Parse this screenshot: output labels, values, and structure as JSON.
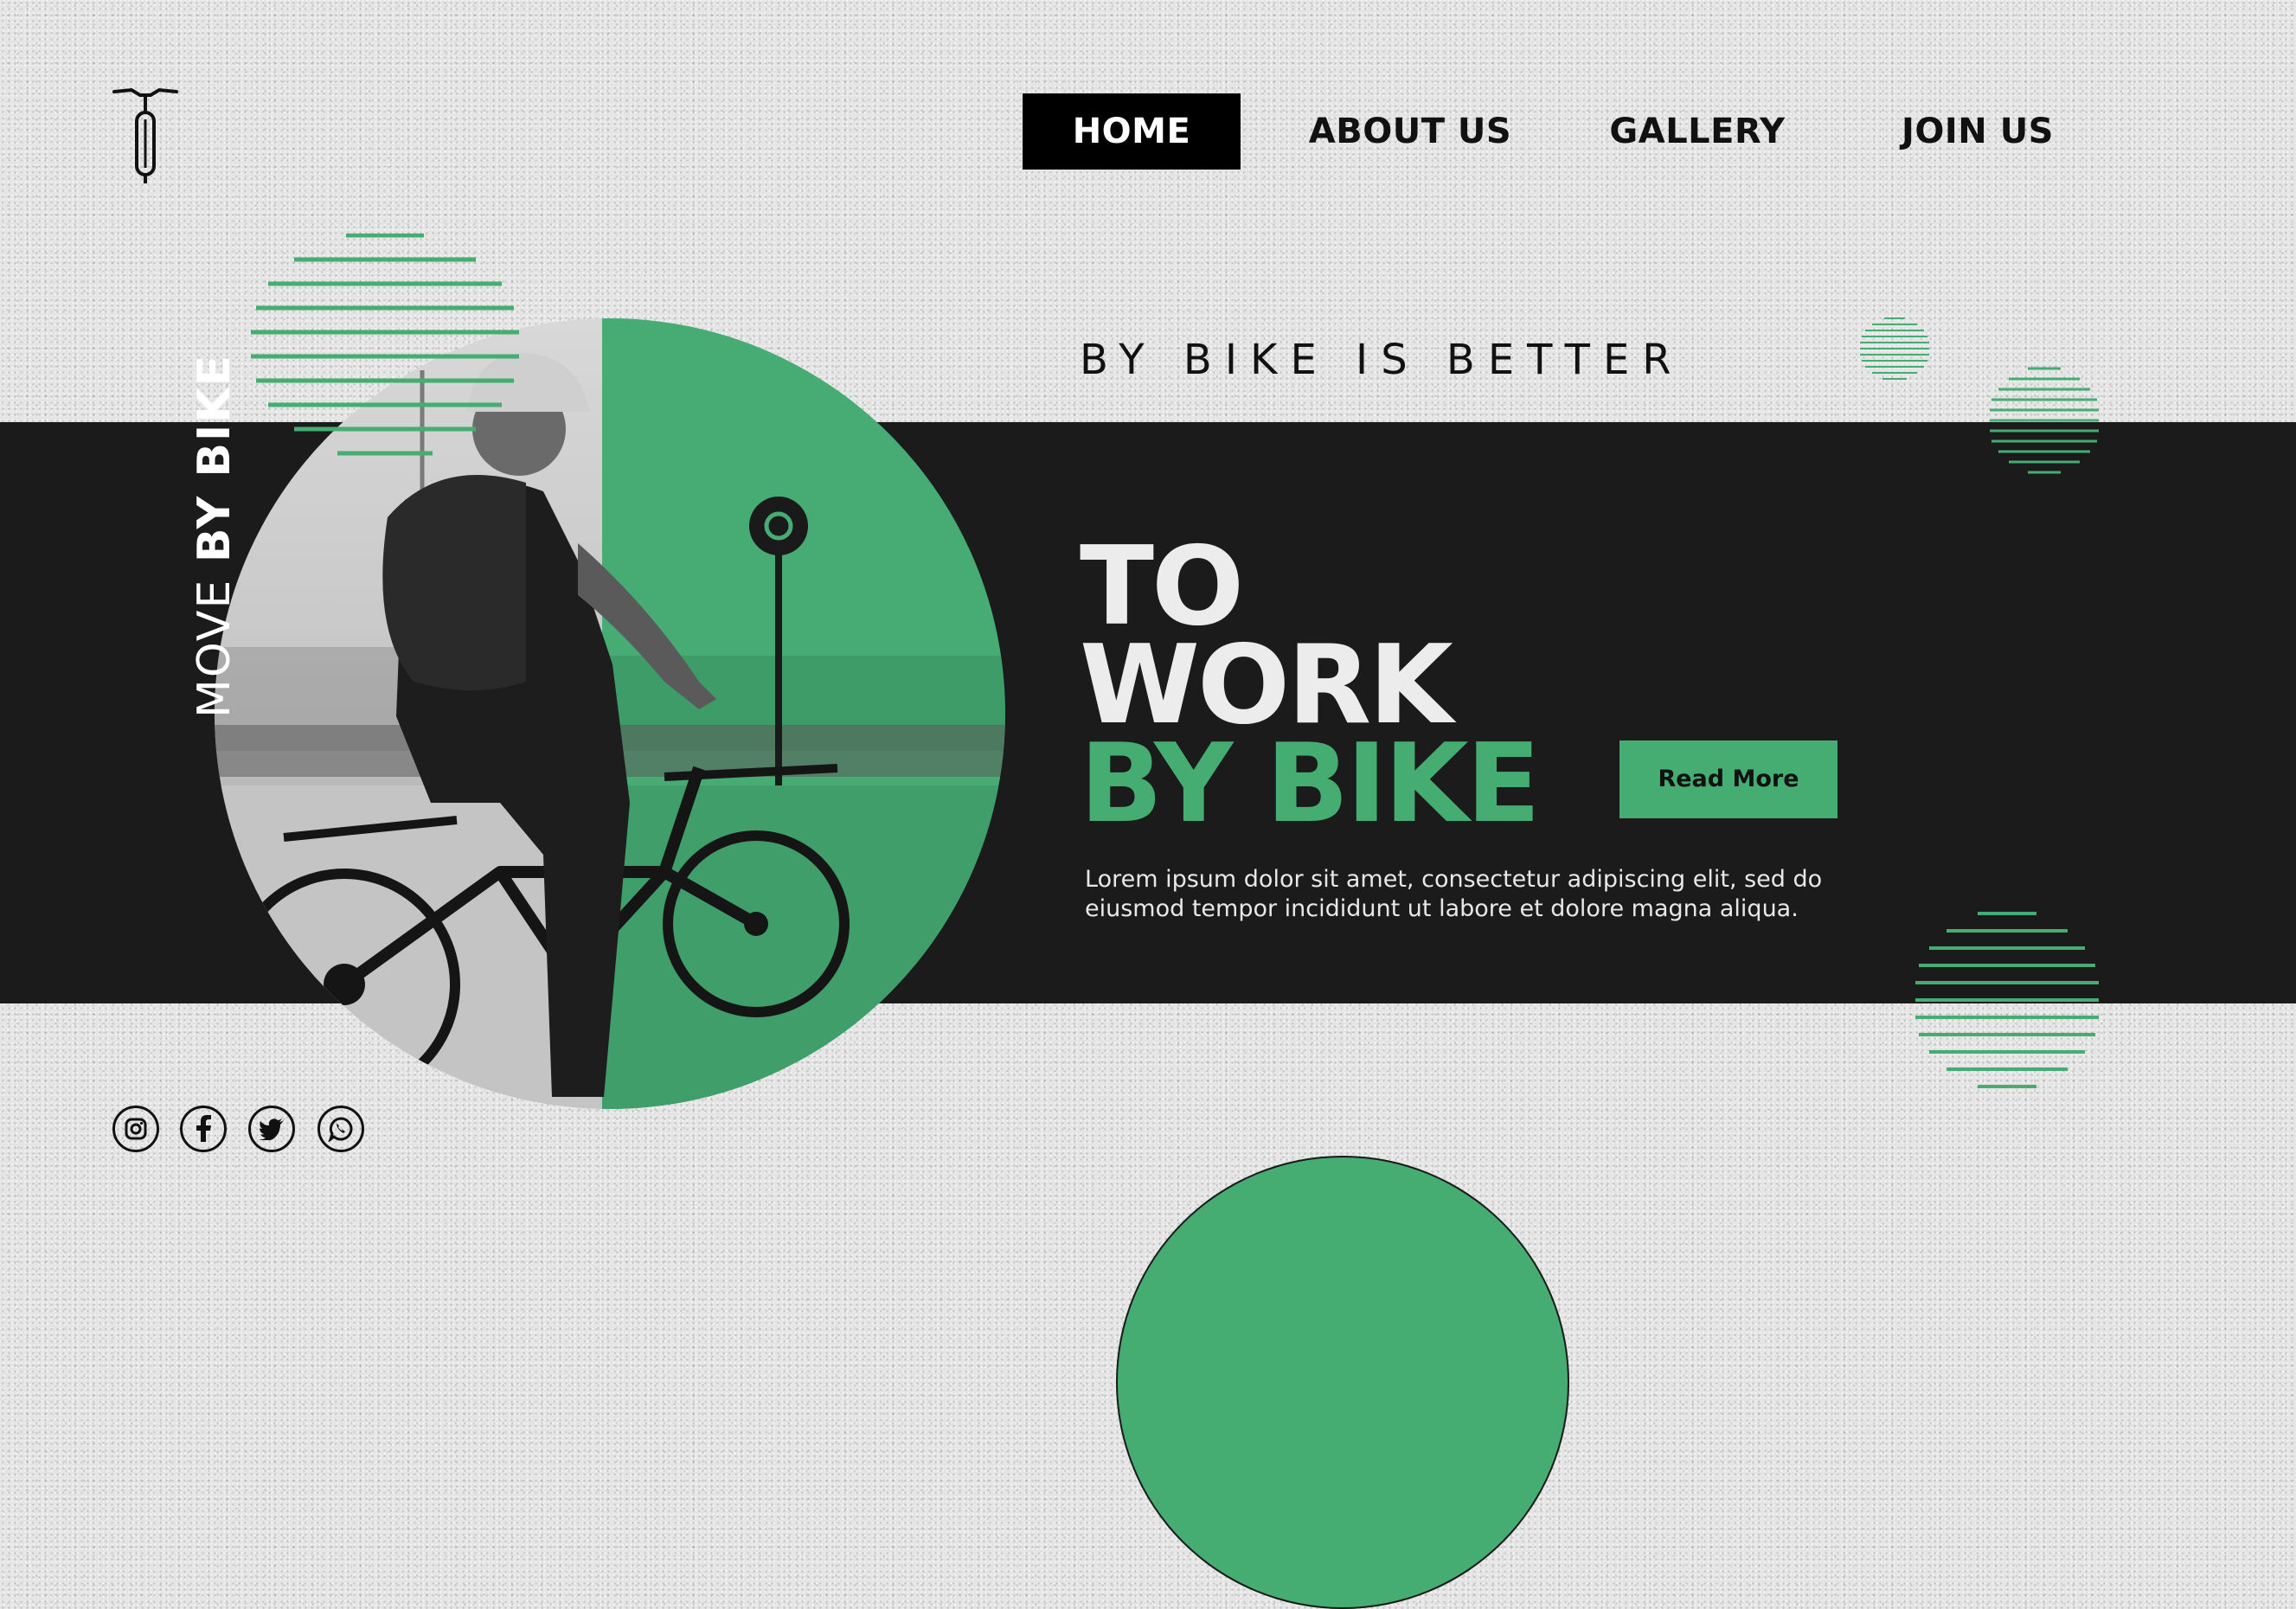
{
  "brand": {
    "logo_icon": "bicycle-icon"
  },
  "nav": {
    "items": [
      {
        "label": "HOME",
        "active": true
      },
      {
        "label": "ABOUT US",
        "active": false
      },
      {
        "label": "GALLERY",
        "active": false
      },
      {
        "label": "JOIN US",
        "active": false
      }
    ]
  },
  "hero": {
    "tagline": "BY BIKE IS BETTER",
    "headline_line1": "TO",
    "headline_line2": "WORK",
    "headline_line3": "BY BIKE",
    "vertical_text_light": "MOVE ",
    "vertical_text_bold": "BY BIKE",
    "cta_label": "Read More",
    "body_text": "Lorem ipsum dolor sit amet, consectetur adipiscing elit, sed do eiusmod tempor incididunt ut labore et dolore magna aliqua."
  },
  "social": {
    "icons": [
      "instagram-icon",
      "facebook-icon",
      "twitter-icon",
      "whatsapp-icon"
    ]
  },
  "colors": {
    "accent": "#45ad72",
    "dark": "#1b1b1b",
    "background": "#e4e4e4"
  }
}
